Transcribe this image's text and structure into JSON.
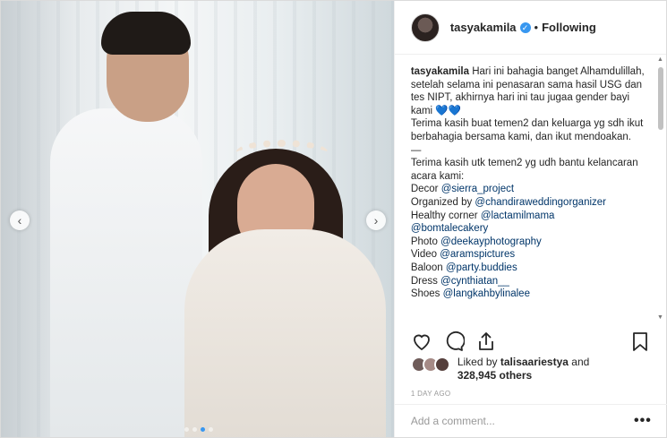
{
  "post": {
    "username": "tasyakamila",
    "separator": "•",
    "follow_status": "Following",
    "caption": [
      {
        "type": "text",
        "text": "Hari ini bahagia banget Alhamdulillah, setelah selama ini penasaran sama hasil USG dan tes NIPT, akhirnya hari ini tau jugaa gender bayi kami "
      },
      {
        "type": "hearts",
        "text": "💙💙"
      },
      {
        "type": "text",
        "text": "Terima kasih buat temen2 dan keluarga yg sdh ikut berbahagia bersama kami, dan ikut mendoakan."
      },
      {
        "type": "text",
        "text": "—"
      },
      {
        "type": "text",
        "text": "Terima kasih utk temen2 yg udh bantu kelancaran acara kami:"
      }
    ],
    "credits": [
      {
        "label": "Decor",
        "mention": "@sierra_project"
      },
      {
        "label": "Organized by",
        "mention": "@chandiraweddingorganizer"
      },
      {
        "label": "Healthy corner",
        "mention": "@lactamilmama"
      },
      {
        "label": "",
        "mention": "@bomtalecakery"
      },
      {
        "label": "Photo",
        "mention": "@deekayphotography"
      },
      {
        "label": "Video",
        "mention": "@aramspictures"
      },
      {
        "label": "Baloon",
        "mention": "@party.buddies"
      },
      {
        "label": "Dress",
        "mention": "@cynthiatan__"
      },
      {
        "label": "Shoes",
        "mention": "@langkahbylinalee"
      }
    ],
    "liked_by_prefix": "Liked by",
    "liked_by_user": "talisaariestya",
    "liked_by_and": "and",
    "others_count": "328,945 others",
    "date": "1 DAY AGO",
    "comment_placeholder": "Add a comment...",
    "more_label": "•••",
    "nav_prev": "‹",
    "nav_next": "›",
    "carousel_index": 3,
    "carousel_total": 4
  },
  "icons": {
    "heart": "heart-icon",
    "comment": "comment-icon",
    "share": "share-icon",
    "save": "bookmark-icon",
    "verified": "verified-badge-icon"
  },
  "colors": {
    "link": "#003569",
    "accent": "#3897f0",
    "muted": "#999999",
    "text": "#262626"
  }
}
